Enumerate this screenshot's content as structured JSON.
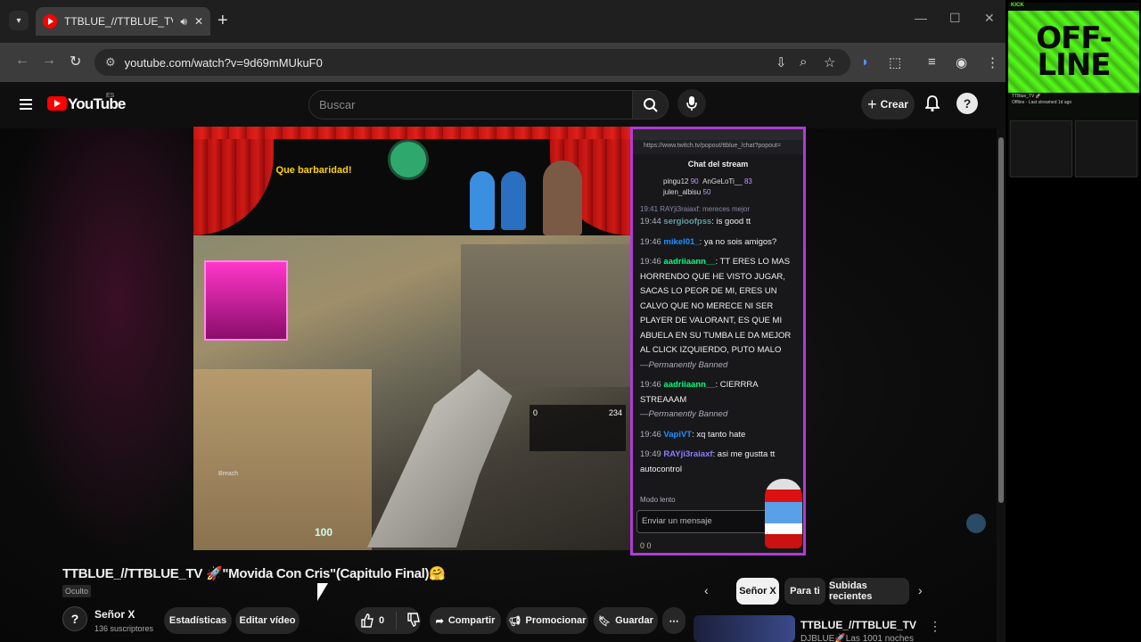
{
  "browser": {
    "tab_title": "TTBLUE_//TTBLUE_TV 🚀\"M",
    "url_site_icon": "site-info-icon",
    "url": "youtube.com/watch?v=9d69mMUkuF0"
  },
  "youtube": {
    "logo_text": "YouTube",
    "region": "ES",
    "search_placeholder": "Buscar",
    "create_label": "Crear"
  },
  "stream_overlay": {
    "banner_text": "Que barbaridad!",
    "hp": "100",
    "ammo": "234",
    "ammo_left": "0",
    "agent_label": "Breach"
  },
  "chat": {
    "popout_url": "https://www.twitch.tv/popout/ttblue_/chat?popout=",
    "title": "Chat del stream",
    "gifts": [
      {
        "name": "pingu12",
        "count": "90"
      },
      {
        "name": "AnGeLoTi__",
        "count": "83"
      },
      {
        "name": "julen_albisu",
        "count": "50"
      }
    ],
    "partial_top": "19:41 RAYji3raiaxf: mereces mejor",
    "messages": [
      {
        "time": "19:44",
        "user": "sergioofpss",
        "color": "#5f9ea0",
        "text": ": is good tt",
        "banned": ""
      },
      {
        "time": "19:46",
        "user": "mikel01_",
        "color": "#1e90ff",
        "text": ": ya no sois amigos?",
        "banned": ""
      },
      {
        "time": "19:46",
        "user": "aadriiaann__",
        "color": "#00ff7f",
        "text": ": TT ERES LO MAS HORRENDO QUE HE VISTO JUGAR, SACAS LO PEOR DE MI, ERES UN CALVO QUE NO MERECE NI SER PLAYER DE VALORANT, ES QUE MI ABUELA EN SU TUMBA LE DA MEJOR AL CLICK IZQUIERDO, PUTO MALO",
        "banned": "—Permanently Banned"
      },
      {
        "time": "19:46",
        "user": "aadriiaann__",
        "color": "#00ff7f",
        "text": ": CIERRRA STREAAAM",
        "banned": "—Permanently Banned"
      },
      {
        "time": "19:46",
        "user": "VapiVT",
        "color": "#1e90ff",
        "text": ": xq tanto hate",
        "banned": ""
      },
      {
        "time": "19:49",
        "user": "RAYji3raiaxf",
        "color": "#8a7dff",
        "text": ": asi me gustta tt autocontrol",
        "banned": ""
      }
    ],
    "slow_mode": "Modo lento",
    "input_placeholder": "Enviar un mensaje",
    "footer": "0   0"
  },
  "video": {
    "title": "TTBLUE_//TTBLUE_TV 🚀\"Movida Con Cris\"(Capitulo Final)🤗",
    "visibility": "Oculto",
    "channel_name": "Señor X",
    "subscribers": "136 suscriptores",
    "stats_button": "Estadísticas",
    "edit_button": "Editar vídeo",
    "likes": "0",
    "share_label": "Compartir",
    "promote_label": "Promocionar",
    "save_label": "Guardar"
  },
  "chips": [
    "Señor X",
    "Para ti",
    "Subidas recientes"
  ],
  "recommendation": {
    "title": "TTBLUE_//TTBLUE_TV",
    "subtitle": "DJBLUE🚀Las 1001 noches"
  },
  "kick": {
    "brand": "KICK",
    "offline_text": "OFF-LINE",
    "channel": "TTBlue_TV 🚀",
    "info": "Offline · Last streamed 1d ago"
  },
  "colors": {
    "accent_red": "#ff0000",
    "chat_border": "#b23ad6",
    "kick_green": "#53fc18"
  }
}
